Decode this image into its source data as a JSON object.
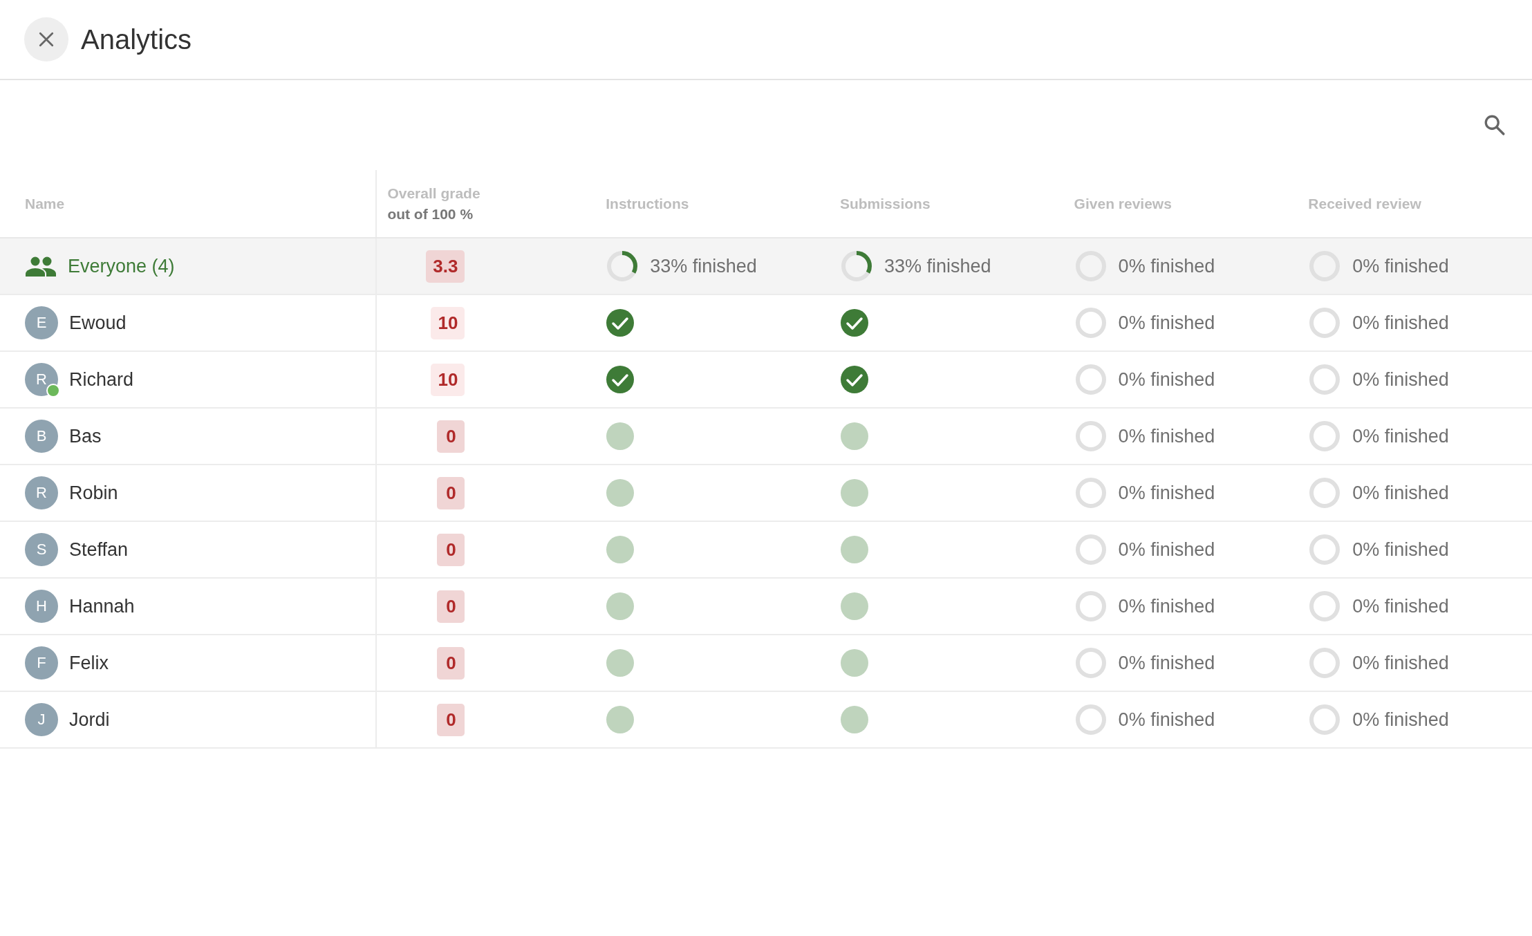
{
  "header": {
    "title": "Analytics"
  },
  "table": {
    "columns": [
      {
        "label": "Name"
      },
      {
        "label": "Overall grade",
        "sublabel": "out of 100 %"
      },
      {
        "label": "Instructions"
      },
      {
        "label": "Submissions"
      },
      {
        "label": "Given reviews"
      },
      {
        "label": "Received review"
      }
    ],
    "rows": [
      {
        "kind": "group",
        "name": "Everyone (4)",
        "grade": {
          "text": "3.3",
          "kind": "strong"
        },
        "cells": [
          {
            "kind": "progress",
            "level": 0.33,
            "text": "33% finished"
          },
          {
            "kind": "progress",
            "level": 0.33,
            "text": "33% finished"
          },
          {
            "kind": "progress",
            "level": 0,
            "text": "0% finished"
          },
          {
            "kind": "progress",
            "level": 0,
            "text": "0% finished"
          }
        ]
      },
      {
        "kind": "person",
        "initial": "E",
        "name": "Ewoud",
        "online": false,
        "grade": {
          "text": "10",
          "kind": "light"
        },
        "cells": [
          {
            "kind": "done"
          },
          {
            "kind": "done"
          },
          {
            "kind": "progress",
            "level": 0,
            "text": "0% finished"
          },
          {
            "kind": "progress",
            "level": 0,
            "text": "0% finished"
          }
        ]
      },
      {
        "kind": "person",
        "initial": "R",
        "name": "Richard",
        "online": true,
        "grade": {
          "text": "10",
          "kind": "light"
        },
        "cells": [
          {
            "kind": "done"
          },
          {
            "kind": "done"
          },
          {
            "kind": "progress",
            "level": 0,
            "text": "0% finished"
          },
          {
            "kind": "progress",
            "level": 0,
            "text": "0% finished"
          }
        ]
      },
      {
        "kind": "person",
        "initial": "B",
        "name": "Bas",
        "online": false,
        "grade": {
          "text": "0",
          "kind": "strong"
        },
        "cells": [
          {
            "kind": "pending"
          },
          {
            "kind": "pending"
          },
          {
            "kind": "progress",
            "level": 0,
            "text": "0% finished"
          },
          {
            "kind": "progress",
            "level": 0,
            "text": "0% finished"
          }
        ]
      },
      {
        "kind": "person",
        "initial": "R",
        "name": "Robin",
        "online": false,
        "grade": {
          "text": "0",
          "kind": "strong"
        },
        "cells": [
          {
            "kind": "pending"
          },
          {
            "kind": "pending"
          },
          {
            "kind": "progress",
            "level": 0,
            "text": "0% finished"
          },
          {
            "kind": "progress",
            "level": 0,
            "text": "0% finished"
          }
        ]
      },
      {
        "kind": "person",
        "initial": "S",
        "name": "Steffan",
        "online": false,
        "grade": {
          "text": "0",
          "kind": "strong"
        },
        "cells": [
          {
            "kind": "pending"
          },
          {
            "kind": "pending"
          },
          {
            "kind": "progress",
            "level": 0,
            "text": "0% finished"
          },
          {
            "kind": "progress",
            "level": 0,
            "text": "0% finished"
          }
        ]
      },
      {
        "kind": "person",
        "initial": "H",
        "name": "Hannah",
        "online": false,
        "grade": {
          "text": "0",
          "kind": "strong"
        },
        "cells": [
          {
            "kind": "pending"
          },
          {
            "kind": "pending"
          },
          {
            "kind": "progress",
            "level": 0,
            "text": "0% finished"
          },
          {
            "kind": "progress",
            "level": 0,
            "text": "0% finished"
          }
        ]
      },
      {
        "kind": "person",
        "initial": "F",
        "name": "Felix",
        "online": false,
        "grade": {
          "text": "0",
          "kind": "strong"
        },
        "cells": [
          {
            "kind": "pending"
          },
          {
            "kind": "pending"
          },
          {
            "kind": "progress",
            "level": 0,
            "text": "0% finished"
          },
          {
            "kind": "progress",
            "level": 0,
            "text": "0% finished"
          }
        ]
      },
      {
        "kind": "person",
        "initial": "J",
        "name": "Jordi",
        "online": false,
        "grade": {
          "text": "0",
          "kind": "strong"
        },
        "cells": [
          {
            "kind": "pending"
          },
          {
            "kind": "pending"
          },
          {
            "kind": "progress",
            "level": 0,
            "text": "0% finished"
          },
          {
            "kind": "progress",
            "level": 0,
            "text": "0% finished"
          }
        ]
      }
    ]
  }
}
